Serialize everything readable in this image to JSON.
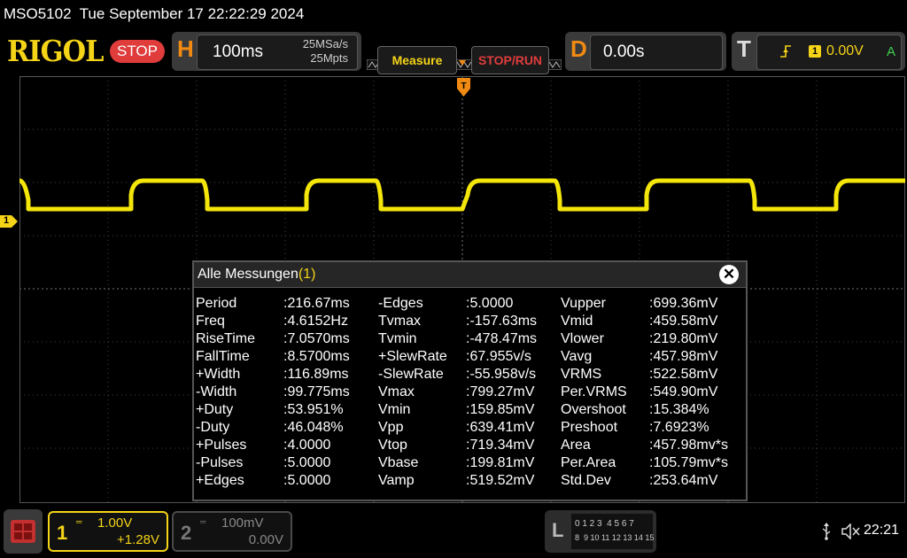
{
  "title_bar": {
    "text": "MSO5102  Tue September 17 22:22:29 2024"
  },
  "header": {
    "logo": "RIGOL",
    "run_state": "STOP",
    "horizontal": {
      "letter": "H",
      "timebase": "100ms",
      "sample_rate": "25MSa/s",
      "memory_depth": "25Mpts"
    },
    "measure_label": "Measure",
    "stop_run_label": "STOP/RUN",
    "delay": {
      "letter": "D",
      "value": "0.00s"
    },
    "trigger": {
      "letter": "T",
      "source": "1",
      "level": "0.00V",
      "mode": "A"
    }
  },
  "grid": {
    "ch1_marker": "1"
  },
  "measurements": {
    "title": "Alle Messungen",
    "channel": "(1)",
    "columns": [
      [
        {
          "name": "Period",
          "value": ":216.67ms"
        },
        {
          "name": "Freq",
          "value": ":4.6152Hz"
        },
        {
          "name": "RiseTime",
          "value": ":7.0570ms"
        },
        {
          "name": "FallTime",
          "value": ":8.5700ms"
        },
        {
          "name": "+Width",
          "value": ":116.89ms"
        },
        {
          "name": "-Width",
          "value": ":99.775ms"
        },
        {
          "name": "+Duty",
          "value": ":53.951%"
        },
        {
          "name": "-Duty",
          "value": ":46.048%"
        },
        {
          "name": "+Pulses",
          "value": ":4.0000"
        },
        {
          "name": "-Pulses",
          "value": ":5.0000"
        },
        {
          "name": "+Edges",
          "value": ":5.0000"
        }
      ],
      [
        {
          "name": "-Edges",
          "value": ":5.0000"
        },
        {
          "name": "Tvmax",
          "value": ":-157.63ms"
        },
        {
          "name": "Tvmin",
          "value": ":-478.47ms"
        },
        {
          "name": "+SlewRate",
          "value": ":67.955v/s"
        },
        {
          "name": "-SlewRate",
          "value": ":-55.958v/s"
        },
        {
          "name": "Vmax",
          "value": ":799.27mV"
        },
        {
          "name": "Vmin",
          "value": ":159.85mV"
        },
        {
          "name": "Vpp",
          "value": ":639.41mV"
        },
        {
          "name": "Vtop",
          "value": ":719.34mV"
        },
        {
          "name": "Vbase",
          "value": ":199.81mV"
        },
        {
          "name": "Vamp",
          "value": ":519.52mV"
        }
      ],
      [
        {
          "name": "Vupper",
          "value": ":699.36mV"
        },
        {
          "name": "Vmid",
          "value": ":459.58mV"
        },
        {
          "name": "Vlower",
          "value": ":219.80mV"
        },
        {
          "name": "Vavg",
          "value": ":457.98mV"
        },
        {
          "name": "VRMS",
          "value": ":522.58mV"
        },
        {
          "name": "Per.VRMS",
          "value": ":549.90mV"
        },
        {
          "name": "Overshoot",
          "value": ":15.384%"
        },
        {
          "name": "Preshoot",
          "value": ":7.6923%"
        },
        {
          "name": "Area",
          "value": ":457.98mv*s"
        },
        {
          "name": "Per.Area",
          "value": ":105.79mv*s"
        },
        {
          "name": "Std.Dev",
          "value": ":253.64mV"
        }
      ]
    ]
  },
  "bottom": {
    "ch1": {
      "num": "1",
      "scale": "1.00V",
      "offset": "+1.28V"
    },
    "ch2": {
      "num": "2",
      "scale": "100mV",
      "offset": "0.00V"
    },
    "la": {
      "letter": "L",
      "row1": "0 1 2 3  4 5 6 7",
      "row2": "8  9 10 11 12 13 14 15"
    },
    "time": "22:21"
  },
  "colors": {
    "ch1": "#f5d418",
    "accent": "#f08a12",
    "stop": "#e03c3c"
  }
}
